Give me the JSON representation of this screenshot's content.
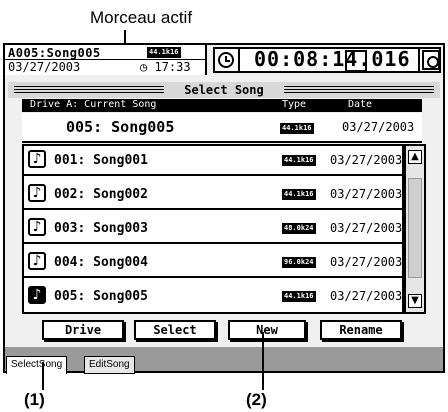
{
  "callouts": {
    "top_label": "Morceau actif",
    "marker_1": "(1)",
    "marker_2": "(2)"
  },
  "header": {
    "song_title": "A005:Song005",
    "badge": "44.1k16",
    "date": "03/27/2003",
    "clock": "◷ 17:33",
    "timecode": "00:08:14.016"
  },
  "titlebar": {
    "title": "Select Song"
  },
  "columns": {
    "drive_label": "Drive A: Current Song",
    "type": "Type",
    "date": "Date"
  },
  "current_song": {
    "name": "005: Song005",
    "badge": "44.1k16",
    "date": "03/27/2003"
  },
  "songs": [
    {
      "name": "001: Song001",
      "badge": "44.1k16",
      "date": "03/27/2003"
    },
    {
      "name": "002: Song002",
      "badge": "44.1k16",
      "date": "03/27/2003"
    },
    {
      "name": "003: Song003",
      "badge": "48.0k24",
      "date": "03/27/2003"
    },
    {
      "name": "004: Song004",
      "badge": "96.0k24",
      "date": "03/27/2003"
    },
    {
      "name": "005: Song005",
      "badge": "44.1k16",
      "date": "03/27/2003"
    }
  ],
  "icons": {
    "song": "♪",
    "up": "▲",
    "down": "▼"
  },
  "buttons": {
    "drive": "Drive",
    "select": "Select",
    "new": "New",
    "rename": "Rename"
  },
  "tabs": {
    "select_song": "SelectSong",
    "edit_song": "EditSong"
  }
}
